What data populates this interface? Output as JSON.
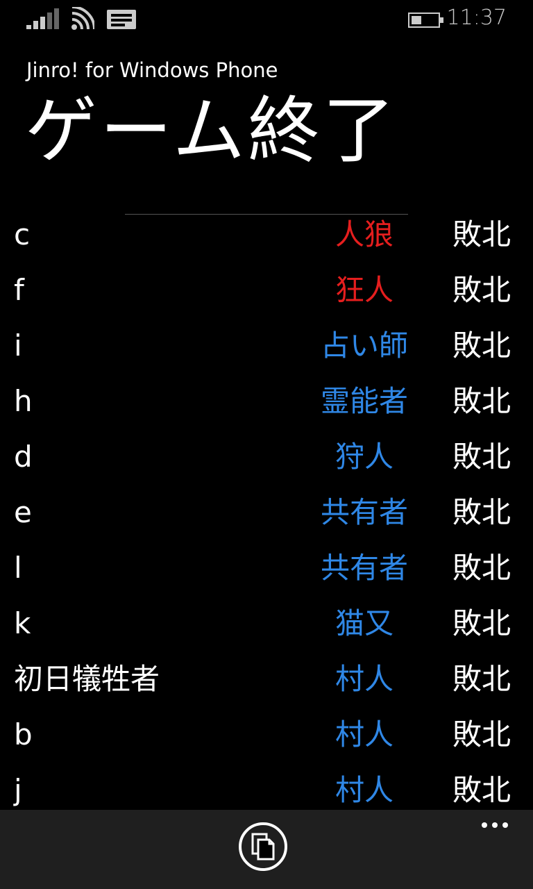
{
  "status_bar": {
    "time": "11:37",
    "icons": [
      "signal-icon",
      "wifi-icon",
      "message-icon",
      "battery-icon"
    ]
  },
  "header": {
    "app_title": "Jinro! for Windows Phone",
    "page_title": "ゲーム終了"
  },
  "colors": {
    "wolf_team": "#e51e1e",
    "village_team": "#2f87e6",
    "text": "#ffffff",
    "app_bar": "#1f1f1f"
  },
  "results": [
    {
      "player": "c",
      "role": "人狼",
      "team": "wolf",
      "outcome": "敗北"
    },
    {
      "player": "f",
      "role": "狂人",
      "team": "wolf",
      "outcome": "敗北"
    },
    {
      "player": "i",
      "role": "占い師",
      "team": "village",
      "outcome": "敗北"
    },
    {
      "player": "h",
      "role": "霊能者",
      "team": "village",
      "outcome": "敗北"
    },
    {
      "player": "d",
      "role": "狩人",
      "team": "village",
      "outcome": "敗北"
    },
    {
      "player": "e",
      "role": "共有者",
      "team": "village",
      "outcome": "敗北"
    },
    {
      "player": "l",
      "role": "共有者",
      "team": "village",
      "outcome": "敗北"
    },
    {
      "player": "k",
      "role": "猫又",
      "team": "village",
      "outcome": "敗北"
    },
    {
      "player": "初日犠牲者",
      "role": "村人",
      "team": "village",
      "outcome": "敗北"
    },
    {
      "player": "b",
      "role": "村人",
      "team": "village",
      "outcome": "敗北"
    },
    {
      "player": "j",
      "role": "村人",
      "team": "village",
      "outcome": "敗北"
    }
  ],
  "app_bar": {
    "buttons": [
      "copy-icon"
    ],
    "more_icon": "ellipsis-icon"
  }
}
